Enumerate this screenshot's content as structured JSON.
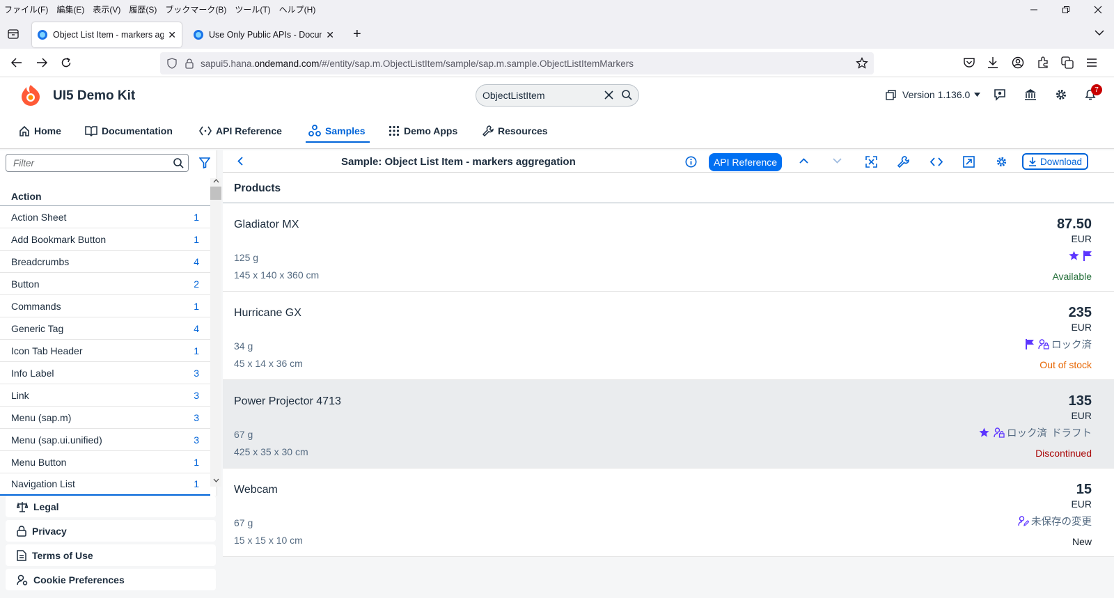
{
  "browser": {
    "menu": [
      "ファイル(F)",
      "編集(E)",
      "表示(V)",
      "履歴(S)",
      "ブックマーク(B)",
      "ツール(T)",
      "ヘルプ(H)"
    ],
    "tabs": [
      {
        "title": "Object List Item - markers aggregation",
        "close": "✕"
      },
      {
        "title": "Use Only Public APIs - Documentation",
        "close": "✕"
      }
    ],
    "new_tab": "+",
    "url_prefix": "sapui5.hana.",
    "url_domain": "ondemand.com",
    "url_suffix": "/#/entity/sap.m.ObjectListItem/sample/sap.m.sample.ObjectListItemMarkers"
  },
  "header": {
    "title": "UI5 Demo Kit",
    "search_value": "ObjectListItem",
    "version": "Version 1.136.0",
    "notification_count": "7",
    "nav": [
      "Home",
      "Documentation",
      "API Reference",
      "Samples",
      "Demo Apps",
      "Resources"
    ]
  },
  "sidebar": {
    "filter_placeholder": "Filter",
    "group": "Action",
    "items": [
      {
        "label": "Action Sheet",
        "count": "1"
      },
      {
        "label": "Add Bookmark Button",
        "count": "1"
      },
      {
        "label": "Breadcrumbs",
        "count": "4"
      },
      {
        "label": "Button",
        "count": "2"
      },
      {
        "label": "Commands",
        "count": "1"
      },
      {
        "label": "Generic Tag",
        "count": "4"
      },
      {
        "label": "Icon Tab Header",
        "count": "1"
      },
      {
        "label": "Info Label",
        "count": "3"
      },
      {
        "label": "Link",
        "count": "3"
      },
      {
        "label": "Menu (sap.m)",
        "count": "3"
      },
      {
        "label": "Menu (sap.ui.unified)",
        "count": "3"
      },
      {
        "label": "Menu Button",
        "count": "1"
      },
      {
        "label": "Navigation List",
        "count": "1"
      }
    ],
    "footer": [
      "Legal",
      "Privacy",
      "Terms of Use",
      "Cookie Preferences"
    ]
  },
  "sample": {
    "title": "Sample: Object List Item - markers aggregation",
    "api_reference": "API Reference",
    "download": "Download",
    "list_title": "Products",
    "products": [
      {
        "name": "Gladiator MX",
        "weight": "125 g",
        "dims": "145 x 140 x 360 cm",
        "price": "87.50",
        "unit": "EUR",
        "status": "Available",
        "status_color": "#256f3a",
        "locked": "",
        "draft": "",
        "unsaved": ""
      },
      {
        "name": "Hurricane GX",
        "weight": "34 g",
        "dims": "45 x 14 x 36 cm",
        "price": "235",
        "unit": "EUR",
        "status": "Out of stock",
        "status_color": "#e76500",
        "locked": "ロック済",
        "draft": "",
        "unsaved": ""
      },
      {
        "name": "Power Projector 4713",
        "weight": "67 g",
        "dims": "425 x 35 x 30 cm",
        "price": "135",
        "unit": "EUR",
        "status": "Discontinued",
        "status_color": "#aa0808",
        "locked": "ロック済",
        "draft": "ドラフト",
        "unsaved": ""
      },
      {
        "name": "Webcam",
        "weight": "67 g",
        "dims": "15 x 15 x 10 cm",
        "price": "15",
        "unit": "EUR",
        "status": "New",
        "status_color": "#131e29",
        "locked": "",
        "draft": "",
        "unsaved": "未保存の変更"
      }
    ]
  },
  "colors": {
    "accent": "#0064d9",
    "marker": "#5d36ff"
  }
}
